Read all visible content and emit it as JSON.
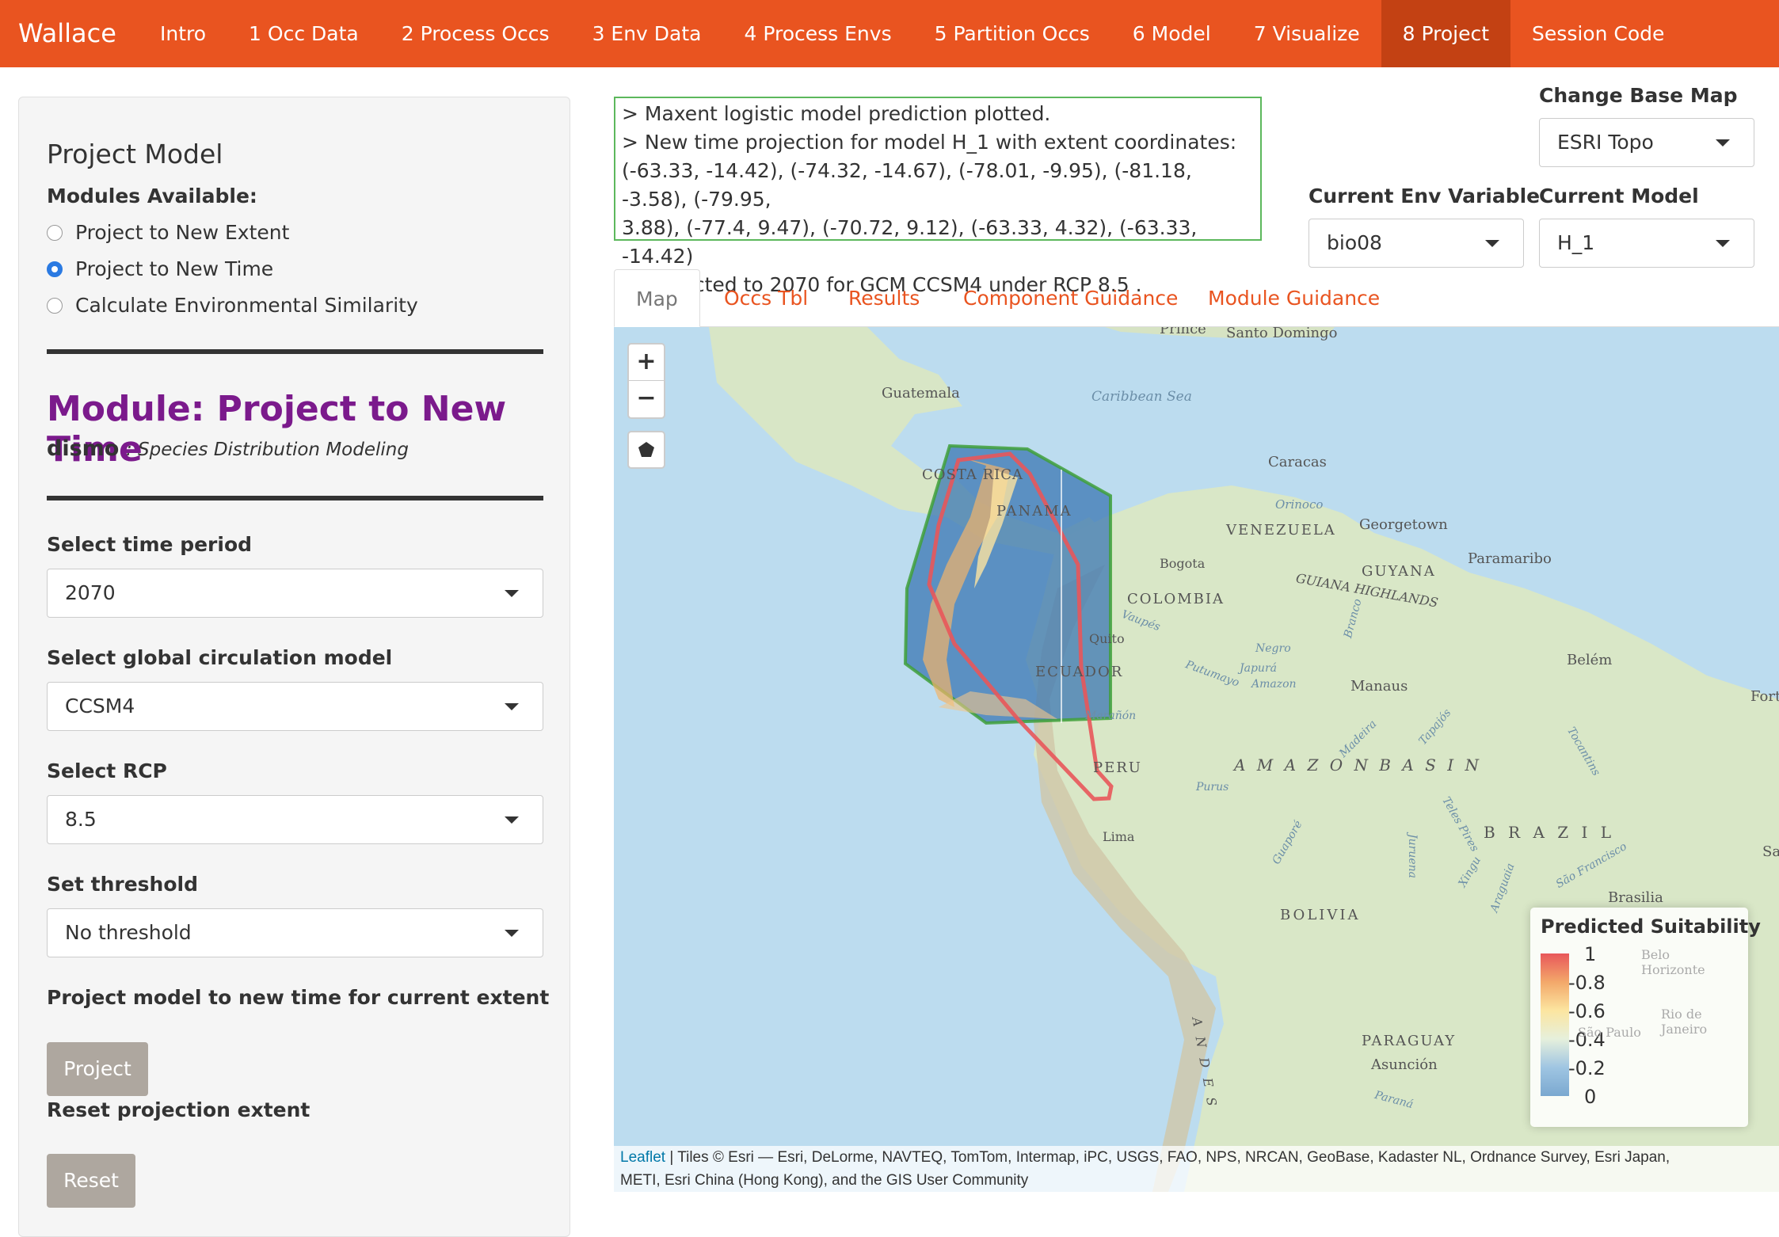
{
  "navbar": {
    "brand": "Wallace",
    "items": [
      "Intro",
      "1 Occ Data",
      "2 Process Occs",
      "3 Env Data",
      "4 Process Envs",
      "5 Partition Occs",
      "6 Model",
      "7 Visualize",
      "8 Project",
      "Session Code"
    ],
    "active": "8 Project"
  },
  "sidebar": {
    "title": "Project Model",
    "modules_label": "Modules Available:",
    "modules": [
      {
        "label": "Project to New Extent",
        "checked": false
      },
      {
        "label": "Project to New Time",
        "checked": true
      },
      {
        "label": "Calculate Environmental Similarity",
        "checked": false
      }
    ],
    "module_title": "Module: Project to New Time",
    "package": "dismo",
    "package_desc": ": Species Distribution Modeling",
    "time_label": "Select time period",
    "time_value": "2070",
    "gcm_label": "Select global circulation model",
    "gcm_value": "CCSM4",
    "rcp_label": "Select RCP",
    "rcp_value": "8.5",
    "threshold_label": "Set threshold",
    "threshold_value": "No threshold",
    "project_text": "Project model to new time for current extent",
    "project_button": "Project",
    "reset_text": "Reset projection extent",
    "reset_button": "Reset"
  },
  "log": {
    "lines": [
      "> Maxent logistic model prediction plotted.",
      "> New time projection for model H_1 with extent coordinates:",
      "(-63.33, -14.42), (-74.32, -14.67), (-78.01, -9.95), (-81.18, -3.58), (-79.95,",
      "3.88), (-77.4, 9.47), (-70.72, 9.12), (-63.33, 4.32), (-63.33, -14.42)",
      "> Projected to 2070 for GCM CCSM4 under RCP 8.5 ."
    ]
  },
  "controls": {
    "basemap_label": "Change Base Map",
    "basemap_value": "ESRI Topo",
    "env_label": "Current Env Variable",
    "env_value": "bio08",
    "model_label": "Current Model",
    "model_value": "H_1"
  },
  "tabs": [
    "Map",
    "Occs Tbl",
    "Results",
    "Component Guidance",
    "Module Guidance"
  ],
  "map": {
    "zoom_in": "+",
    "zoom_out": "−",
    "labels": {
      "prince": "Prince",
      "santo_domingo": "Santo Domingo",
      "guatemala": "Guatemala",
      "caribbean": "Caribbean Sea",
      "costa_rica": "COSTA RICA",
      "caracas": "Caracas",
      "panama": "PANAMA",
      "orinoco": "Orinoco",
      "venezuela": "VENEZUELA",
      "georgetown": "Georgetown",
      "guyana": "GUYANA",
      "paramaribo": "Paramaribo",
      "guiana_highlands": "GUIANA HIGHLANDS",
      "bogota": "Bogota",
      "colombia": "COLOMBIA",
      "quito": "Quito",
      "ecuador": "ECUADOR",
      "belem": "Belém",
      "manaus": "Manaus",
      "fort": "Fort",
      "amazon_basin": "A M A Z O N   B A S I N",
      "peru": "PERU",
      "brazil": "B R A Z I L",
      "lima": "Lima",
      "salv": "Salv",
      "brasilia": "Brasilia",
      "bolivia": "BOLIVIA",
      "paraguay": "PARAGUAY",
      "asuncion": "Asunción",
      "belo": "Belo Horizonte",
      "rio": "Rio de Janeiro",
      "sao_paulo": "São Paulo",
      "sao_francisco": "São Francisco",
      "tocantins": "Tocantins",
      "madeira": "Madeira",
      "tapajos": "Tapajós",
      "xingu": "Xingu",
      "teles_pires": "Teles Pires",
      "negro": "Negro",
      "japura": "Japurá",
      "amazon": "Amazon",
      "putumayo": "Putumayo",
      "maranon": "Marañón",
      "purus": "Purus",
      "guapore": "Guaporé",
      "juruena": "Juruena",
      "araguaia": "Araguaia",
      "branco": "Branco",
      "vaupes": "Vaupés",
      "andes": "A N D E S",
      "parana": "Paraná"
    },
    "legend": {
      "title": "Predicted Suitability",
      "ticks": [
        "1",
        "-0.8",
        "-0.6",
        "-0.4",
        "-0.2",
        "0"
      ]
    },
    "attribution_link": "Leaflet",
    "attribution_line1": " | Tiles © Esri — Esri, DeLorme, NAVTEQ, TomTom, Intermap, iPC, USGS, FAO, NPS, NRCAN, GeoBase, Kadaster NL, Ordnance Survey, Esri Japan,",
    "attribution_line2": "METI, Esri China (Hong Kong), and the GIS User Community"
  }
}
